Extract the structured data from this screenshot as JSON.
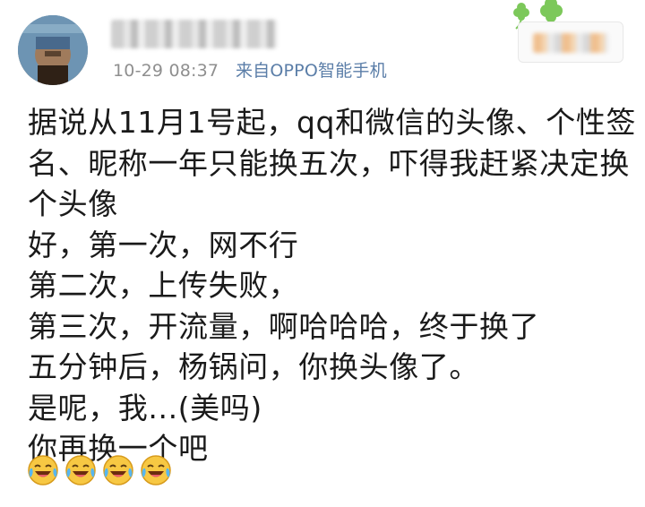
{
  "post": {
    "avatar_icon": "user-avatar-icon",
    "meta": {
      "timestamp": "10-29 08:37",
      "source": "来自OPPO智能手机"
    },
    "lines": [
      "据说从11月1号起，qq和微信的头像、个性签",
      "名、昵称一年只能换五次，吓得我赶紧决定换",
      "个头像",
      "好，第一次，网不行",
      "第二次，上传失败，",
      "第三次，开流量，啊哈哈哈，终于换了",
      "五分钟后，杨锅问，你换头像了。",
      "是呢，我...(美吗)",
      "你再换一个吧"
    ],
    "emojis": [
      "laugh-cry-icon",
      "laugh-cry-icon",
      "laugh-cry-icon",
      "laugh-cry-icon"
    ]
  },
  "colors": {
    "text": "#1a1a1a",
    "meta": "#8f8f8f",
    "source_link": "#5b7ea8",
    "clover": "#6cc24a"
  }
}
